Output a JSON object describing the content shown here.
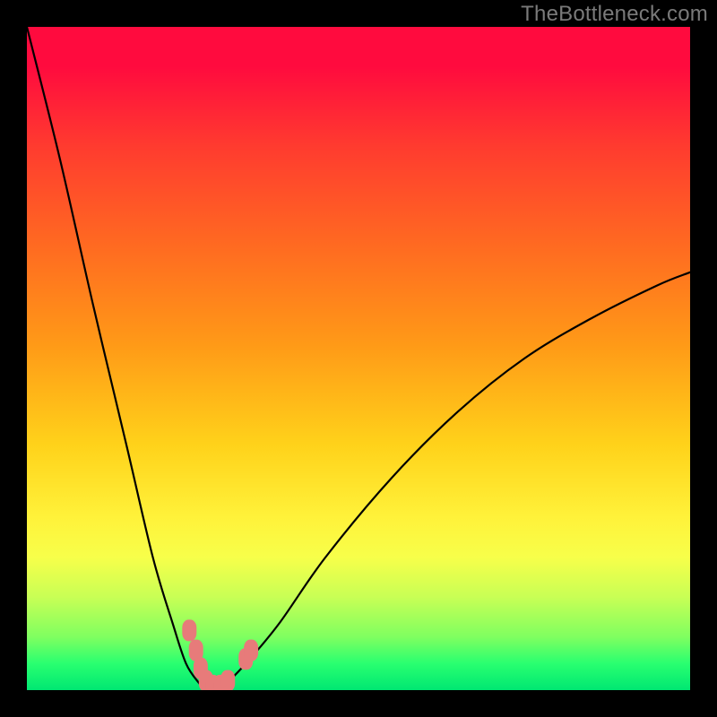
{
  "watermark": "TheBottleneck.com",
  "chart_data": {
    "type": "line",
    "title": "",
    "xlabel": "",
    "ylabel": "",
    "xlim": [
      0,
      100
    ],
    "ylim": [
      0,
      100
    ],
    "grid": false,
    "legend_position": "none",
    "series": [
      {
        "name": "bottleneck-curve",
        "x": [
          0,
          5,
          10,
          15,
          19,
          22,
          24,
          26,
          27,
          28,
          30,
          33,
          38,
          45,
          55,
          65,
          75,
          85,
          95,
          100
        ],
        "y": [
          100,
          80,
          58,
          37,
          20,
          10,
          4,
          1,
          0,
          0,
          1,
          4,
          10,
          20,
          32,
          42,
          50,
          56,
          61,
          63
        ]
      }
    ],
    "markers": {
      "name": "highlight-points",
      "color": "#e77b7a",
      "points": [
        {
          "x": 24.5,
          "y": 9.0
        },
        {
          "x": 25.5,
          "y": 6.0
        },
        {
          "x": 26.2,
          "y": 3.3
        },
        {
          "x": 27.0,
          "y": 1.4
        },
        {
          "x": 28.0,
          "y": 0.7
        },
        {
          "x": 29.2,
          "y": 0.7
        },
        {
          "x": 30.3,
          "y": 1.4
        },
        {
          "x": 33.0,
          "y": 4.7
        },
        {
          "x": 33.8,
          "y": 6.0
        }
      ]
    },
    "gradient_stops": [
      {
        "pos": 0,
        "color": "#ff0b3e"
      },
      {
        "pos": 6,
        "color": "#ff0b3e"
      },
      {
        "pos": 18,
        "color": "#ff3b2f"
      },
      {
        "pos": 33,
        "color": "#ff6a21"
      },
      {
        "pos": 48,
        "color": "#ff9a17"
      },
      {
        "pos": 63,
        "color": "#ffd21a"
      },
      {
        "pos": 74,
        "color": "#fff23a"
      },
      {
        "pos": 80,
        "color": "#f7ff4a"
      },
      {
        "pos": 86,
        "color": "#c8ff55"
      },
      {
        "pos": 92,
        "color": "#7fff60"
      },
      {
        "pos": 96,
        "color": "#29ff70"
      },
      {
        "pos": 100,
        "color": "#00e772"
      }
    ]
  }
}
